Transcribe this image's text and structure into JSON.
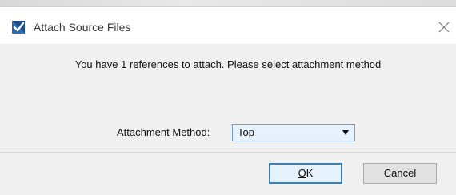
{
  "window": {
    "title": "Attach Source Files",
    "app_icon": "microstation-logo-icon",
    "close_icon": "close-icon"
  },
  "body": {
    "message": "You have 1 references to attach. Please select attachment method",
    "method_label": "Attachment Method:",
    "method_selected": "Top",
    "method_dropdown_icon": "dropdown-arrow-icon"
  },
  "buttons": {
    "ok_mnemonic": "O",
    "ok_rest": "K",
    "cancel": "Cancel"
  },
  "colors": {
    "dialog_bg": "#f0f0f0",
    "titlebar_bg": "#ffffff",
    "select_bg": "#e7f1fb",
    "select_border": "#7a9cc6",
    "default_button_border": "#3c7fb1"
  }
}
